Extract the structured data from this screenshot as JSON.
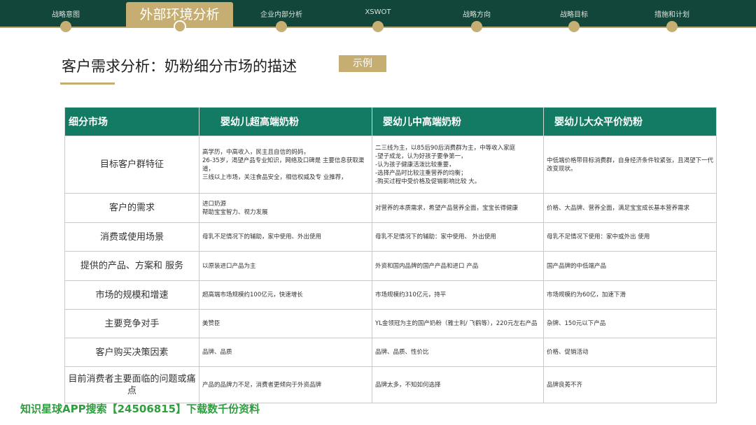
{
  "nav": {
    "items": [
      {
        "label": "战略意图"
      },
      {
        "label": "外部环境分析"
      },
      {
        "label": "企业内部分析"
      },
      {
        "label": "XSWOT"
      },
      {
        "label": "战略方向"
      },
      {
        "label": "战略目标"
      },
      {
        "label": "措施和计划"
      }
    ],
    "active_index": 1
  },
  "page": {
    "title": "客户需求分析：奶粉细分市场的描述",
    "tag": "示例"
  },
  "table": {
    "headers": [
      "细分市场",
      "婴幼儿超高端奶粉",
      "婴幼儿中高端奶粉",
      "婴幼儿大众平价奶粉"
    ],
    "rows": [
      {
        "label": "目标客户群特征",
        "cells": [
          "高学历，中高收入，民主且自信的妈妈，\n26-35岁，渴望产品专业知识，网络及口碑是 主要信息获取渠道，\n三线以上市场，关注食品安全，相信权威及专 业推荐，",
          "二三线为主，以85后90后消费群为主，中等收入家庭\n-望子成龙，认为好孩子要争第一，\n-认为孩子健康活泼比较重要，\n-选择产品时比较注重营养的均衡；\n-购买过程中受价格及促销影响比较 大。",
          "中低端价格带目标消费群，自身经济条件较紧张，且渴望下一代改变现状。"
        ]
      },
      {
        "label": "客户的需求",
        "cells": [
          " 进口奶源\n 帮助宝宝智力、视力发展",
          "对营养的本质需求，希望产品营养全面，宝宝长得健康",
          "价格、大品牌、营养全面，满足宝宝成长基本营养需求"
        ]
      },
      {
        "label": "消费或使用场景",
        "cells": [
          "母乳不足情况下的辅助，家中使用、外出使用",
          "母乳不足情况下的辅助：家中使用、 外出使用",
          "母乳不足情况下使用：家中或外出 使用"
        ]
      },
      {
        "label": "提供的产品、方案和 服务",
        "cells": [
          "以原装进口产品为主",
          "外资和国内品牌的国产产品和进口 产品",
          "国产品牌的中低端产品"
        ]
      },
      {
        "label": "市场的规模和增速",
        "cells": [
          "超高端市场规模约100亿元，快速增长",
          "市场规模约310亿元，持平",
          "市场规模约为60亿，加速下滑"
        ]
      },
      {
        "label": "主要竞争对手",
        "cells": [
          "美赞臣",
          "YL金领冠为主的国产奶粉（雅士利/ 飞鹤等），220元左右产品",
          "杂牌、150元以下产品"
        ]
      },
      {
        "label": "客户购买决策因素",
        "cells": [
          "品牌、品质",
          "品牌、品质、性价比",
          "价格、促销活动"
        ]
      },
      {
        "label": "目前消费者主要面临的问题或痛点",
        "cells": [
          "产品的品牌力不足，消费者更倾向于外资品牌",
          "品牌太多，不知如何选择",
          "品牌良莠不齐"
        ]
      }
    ]
  },
  "watermark": "知识星球APP搜索【24506815】下载数千份资料",
  "colors": {
    "topbar": "#12463a",
    "accent_gold": "#c6ad72",
    "table_header": "#137a63",
    "watermark": "#2e9e3f"
  }
}
